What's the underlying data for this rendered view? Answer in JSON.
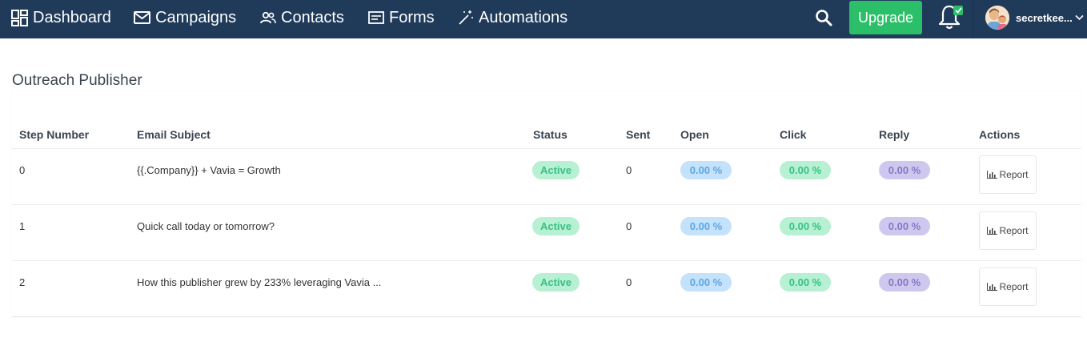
{
  "nav": {
    "items": [
      {
        "label": "Dashboard",
        "icon": "dashboard-icon"
      },
      {
        "label": "Campaigns",
        "icon": "mail-icon"
      },
      {
        "label": "Contacts",
        "icon": "contacts-icon"
      },
      {
        "label": "Forms",
        "icon": "form-icon"
      },
      {
        "label": "Automations",
        "icon": "magic-wand-icon"
      }
    ],
    "upgrade_label": "Upgrade",
    "username": "secretkee...",
    "bell_badge_color": "#2cbf6a",
    "brand_color": "#203a5a"
  },
  "page": {
    "title": "Outreach Publisher"
  },
  "table": {
    "headers": [
      "Step Number",
      "Email Subject",
      "Status",
      "Sent",
      "Open",
      "Click",
      "Reply",
      "Actions"
    ],
    "rows": [
      {
        "step": "0",
        "subject": "{{.Company}} + Vavia = Growth",
        "status": "Active",
        "sent": "0",
        "open": "0.00 %",
        "click": "0.00 %",
        "reply": "0.00 %",
        "action": "Report"
      },
      {
        "step": "1",
        "subject": "Quick call today or tomorrow?",
        "status": "Active",
        "sent": "0",
        "open": "0.00 %",
        "click": "0.00 %",
        "reply": "0.00 %",
        "action": "Report"
      },
      {
        "step": "2",
        "subject": "How this publisher grew by 233% leveraging Vavia ...",
        "status": "Active",
        "sent": "0",
        "open": "0.00 %",
        "click": "0.00 %",
        "reply": "0.00 %",
        "action": "Report"
      }
    ]
  }
}
